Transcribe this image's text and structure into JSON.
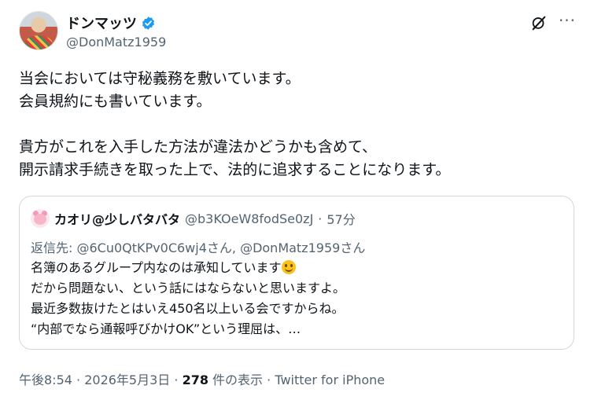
{
  "author": {
    "display_name": "ドンマッツ",
    "handle": "@DonMatz1959",
    "verified": true
  },
  "tweet": {
    "lines": [
      "当会においては守秘義務を敷いています。",
      "会員規約にも書いています。",
      "",
      "貴方がこれを入手した方法が違法かどうかも含めて、",
      "開示請求手続きを取った上で、法的に追求することになります。"
    ]
  },
  "quote": {
    "display_name": "カオリ@少しバタバタ",
    "handle": "@b3KOeW8fodSe0zJ",
    "separator": "·",
    "time": "57分",
    "reply_prefix": "返信先: ",
    "reply_to_1": "@6Cu0QtKPv0C6wj4さん",
    "reply_sep": ", ",
    "reply_to_2": "@DonMatz1959さん",
    "lines": [
      "名簿のあるグループ内なのは承知しています",
      "だから問題ない、という話にはならないと思いますよ。",
      "最近多数抜けたとはいえ450名以上いる会ですからね。",
      "“内部でなら通報呼びかけOK”という理屈は、…"
    ]
  },
  "meta": {
    "time": "午後8:54",
    "sep1": " · ",
    "date": "2026年5月3日",
    "sep2": " · ",
    "views": "278",
    "views_label": " 件の表示",
    "sep3": " · ",
    "source": "Twitter for iPhone"
  },
  "colors": {
    "verified": "#1d9bf0",
    "secondary_text": "#536471",
    "border": "#cfd9de"
  }
}
